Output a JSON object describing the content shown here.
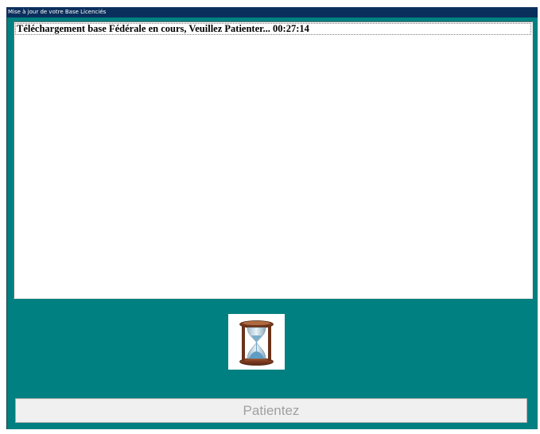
{
  "window": {
    "title": "Mise à jour de votre Base Licenciés"
  },
  "log": {
    "lines": [
      "Téléchargement base Fédérale en cours, Veuillez Patienter... 00:27:14"
    ]
  },
  "hourglass": {
    "icon": "hourglass-icon"
  },
  "status_button": {
    "label": "Patientez",
    "enabled": false
  },
  "colors": {
    "background": "#008080",
    "titlebar": "#0b2f5c",
    "panel": "#ffffff",
    "disabled_text": "#a0a0a0"
  }
}
